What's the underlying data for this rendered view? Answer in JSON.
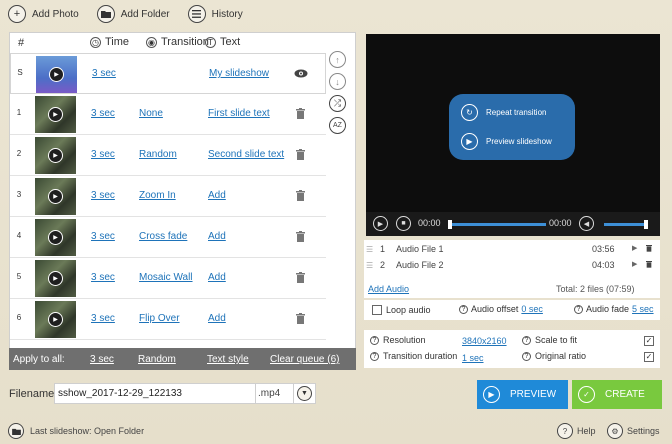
{
  "toolbar": {
    "add_photo": "Add Photo",
    "add_folder": "Add Folder",
    "history": "History"
  },
  "table": {
    "headers": {
      "hash": "#",
      "time": "Time",
      "transition": "Transition",
      "text": "Text"
    },
    "rows": [
      {
        "num": "S",
        "time": "3 sec",
        "transition": "",
        "text": "My slideshow",
        "action": "eye-icon"
      },
      {
        "num": "1",
        "time": "3 sec",
        "transition": "None",
        "text": "First slide text",
        "action": "trash-icon"
      },
      {
        "num": "2",
        "time": "3 sec",
        "transition": "Random",
        "text": "Second slide text",
        "action": "trash-icon"
      },
      {
        "num": "3",
        "time": "3 sec",
        "transition": "Zoom In",
        "text": "Add",
        "action": "trash-icon"
      },
      {
        "num": "4",
        "time": "3 sec",
        "transition": "Cross fade",
        "text": "Add",
        "action": "trash-icon"
      },
      {
        "num": "5",
        "time": "3 sec",
        "transition": "Mosaic Wall",
        "text": "Add",
        "action": "trash-icon"
      },
      {
        "num": "6",
        "time": "3 sec",
        "transition": "Flip Over",
        "text": "Add",
        "action": "trash-icon"
      }
    ]
  },
  "apply_bar": {
    "label": "Apply to all:",
    "time": "3 sec",
    "transition": "Random",
    "text_style": "Text style",
    "clear": "Clear queue (6)"
  },
  "preview": {
    "repeat_transition": "Repeat transition",
    "preview_slideshow": "Preview slideshow",
    "time_current": "00:00",
    "time_total": "00:00"
  },
  "audio": {
    "files": [
      {
        "num": "1",
        "name": "Audio File 1",
        "duration": "03:56"
      },
      {
        "num": "2",
        "name": "Audio File 2",
        "duration": "04:03"
      }
    ],
    "add_audio": "Add Audio",
    "total": "Total: 2 files (07:59)",
    "loop_audio": "Loop audio",
    "audio_offset_label": "Audio offset",
    "audio_offset_value": "0 sec",
    "audio_fade_label": "Audio fade",
    "audio_fade_value": "5 sec"
  },
  "settings": {
    "resolution_label": "Resolution",
    "resolution_value": "3840x2160",
    "transition_duration_label": "Transition duration",
    "transition_duration_value": "1 sec",
    "scale_to_fit": "Scale to fit",
    "original_ratio": "Original ratio"
  },
  "filename": {
    "label": "Filename:",
    "value": "sshow_2017-12-29_122133",
    "ext": ".mp4"
  },
  "buttons": {
    "preview": "PREVIEW",
    "create": "CREATE"
  },
  "bottom": {
    "last_slideshow": "Last slideshow: Open Folder",
    "help": "Help",
    "settings": "Settings"
  },
  "colors": {
    "link": "#1e73b9",
    "preview_button": "#1f8ad8",
    "create_button": "#79c93e",
    "overlay": "#2a6cab"
  }
}
